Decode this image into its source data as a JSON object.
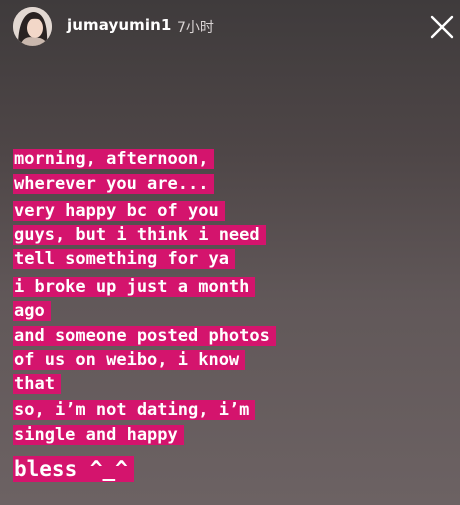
{
  "header": {
    "username": "jumayumin1",
    "time_ago": "7小时",
    "avatar_icon": "profile-photo-icon",
    "close_icon": "close-x-icon"
  },
  "story": {
    "highlight_color": "#d4146d",
    "text_color": "#ffffff",
    "lines": [
      "morning, afternoon,",
      "wherever you are...",
      "very happy bc of you",
      "guys, but i think i need",
      "tell something for ya",
      "i broke up just a month",
      "ago",
      "and someone posted photos",
      "of us on weibo, i know",
      "that",
      "so, i’m not dating, i’m",
      "single and happy",
      "bless ^_^"
    ]
  }
}
